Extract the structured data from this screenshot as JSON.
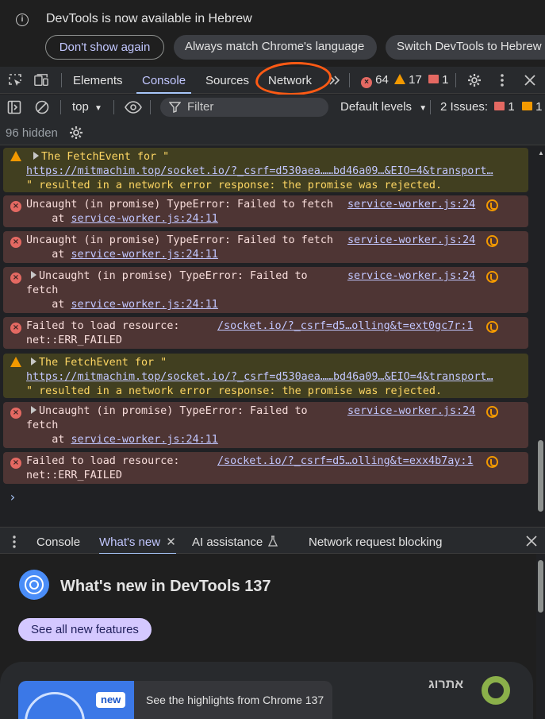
{
  "infobar": {
    "message": "DevTools is now available in Hebrew",
    "buttons": [
      "Don't show again",
      "Always match Chrome's language",
      "Switch DevTools to Hebrew"
    ]
  },
  "tabs": [
    "Elements",
    "Console",
    "Sources",
    "Network"
  ],
  "active_tab": "Console",
  "counters": {
    "errors": "64",
    "warnings": "17",
    "issues": "1"
  },
  "console_toolbar": {
    "context": "top",
    "filter_placeholder": "Filter",
    "levels": "Default levels",
    "issues_label": "2 Issues:",
    "issue_red": "1",
    "issue_orange": "1"
  },
  "hidden_label": "96 hidden",
  "messages": [
    {
      "level": "warning",
      "expandable": true,
      "lines": [
        "The FetchEvent for \"",
        "https://mitmachim.top/socket.io/?_csrf=d530aea……bd46a09…&EIO=4&transport…",
        "\" resulted in a network error response: the promise was rejected."
      ],
      "source": ""
    },
    {
      "level": "error",
      "expandable": false,
      "lines": [
        "Uncaught (in promise) TypeError: Failed to fetch",
        "    at ",
        "service-worker.js:24:11"
      ],
      "source": "service-worker.js:24"
    },
    {
      "level": "error",
      "expandable": false,
      "lines": [
        "Uncaught (in promise) TypeError: Failed to fetch",
        "    at ",
        "service-worker.js:24:11"
      ],
      "source": "service-worker.js:24"
    },
    {
      "level": "error",
      "expandable": true,
      "lines": [
        "Uncaught (in promise) TypeError: Failed to",
        "fetch",
        "    at ",
        "service-worker.js:24:11"
      ],
      "source": "service-worker.js:24"
    },
    {
      "level": "error",
      "expandable": false,
      "lines": [
        "Failed to load resource:",
        "net::ERR_FAILED"
      ],
      "source": "/socket.io/?_csrf=d5…olling&t=ext0gc7r:1"
    },
    {
      "level": "warning",
      "expandable": true,
      "lines": [
        "The FetchEvent for \"",
        "https://mitmachim.top/socket.io/?_csrf=d530aea……bd46a09…&EIO=4&transport…",
        "\" resulted in a network error response: the promise was rejected."
      ],
      "source": ""
    },
    {
      "level": "error",
      "expandable": true,
      "lines": [
        "Uncaught (in promise) TypeError: Failed to",
        "fetch",
        "    at ",
        "service-worker.js:24:11"
      ],
      "source": "service-worker.js:24"
    },
    {
      "level": "error",
      "expandable": false,
      "lines": [
        "Failed to load resource:",
        "net::ERR_FAILED"
      ],
      "source": "/socket.io/?_csrf=d5…olling&t=exx4b7ay:1"
    }
  ],
  "prompt_symbol": "›",
  "drawer": {
    "tabs": [
      "Console",
      "What's new",
      "AI assistance",
      "Network request blocking"
    ],
    "active_tab": "What's new"
  },
  "whats_new": {
    "title": "What's new in DevTools 137",
    "button": "See all new features",
    "badge": "new",
    "caption": "See the highlights from Chrome 137",
    "brand": "אתרוג"
  },
  "icons": {
    "info": "info-icon",
    "inspect": "inspect-element-icon",
    "device": "device-toolbar-icon",
    "more_tabs": "chevron-double-right-icon",
    "settings": "gear-icon",
    "kebab": "more-vert-icon",
    "close": "close-icon",
    "sidebar": "sidebar-toggle-icon",
    "clear": "clear-console-icon",
    "eye": "live-expression-eye-icon",
    "filter": "filter-icon"
  },
  "colors": {
    "accent": "#c2c7ff",
    "error": "#e46962",
    "warning": "#f29900",
    "annotation": "#ff5a14"
  }
}
